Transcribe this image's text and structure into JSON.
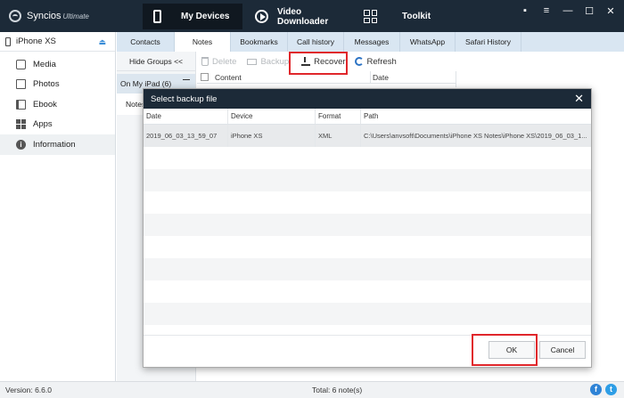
{
  "app": {
    "name": "Syncios",
    "edition": "Ultimate",
    "nav": [
      {
        "label": "My Devices",
        "icon": "phone-icon",
        "active": true
      },
      {
        "label": "Video Downloader",
        "icon": "play-icon",
        "active": false
      },
      {
        "label": "Toolkit",
        "icon": "toolkit-icon",
        "active": false
      }
    ],
    "window_controls": [
      "chat-icon",
      "menu-icon",
      "minimize-icon",
      "maximize-icon",
      "close-icon"
    ]
  },
  "sidebar": {
    "device": "iPhone XS",
    "items": [
      {
        "label": "Media",
        "icon": "media-icon"
      },
      {
        "label": "Photos",
        "icon": "photos-icon"
      },
      {
        "label": "Ebook",
        "icon": "ebook-icon"
      },
      {
        "label": "Apps",
        "icon": "apps-icon"
      },
      {
        "label": "Information",
        "icon": "information-icon",
        "active": true
      }
    ]
  },
  "tabs": [
    "Contacts",
    "Notes",
    "Bookmarks",
    "Call history",
    "Messages",
    "WhatsApp",
    "Safari History"
  ],
  "active_tab": "Notes",
  "groups": {
    "hide_label": "Hide Groups  <<",
    "group_label": "On My iPad (6)",
    "sub_label": "Notes"
  },
  "toolbar": {
    "delete": "Delete",
    "backup": "Backup",
    "recover": "Recover",
    "refresh": "Refresh"
  },
  "table": {
    "col_content": "Content",
    "col_date": "Date"
  },
  "status": {
    "version": "Version: 6.6.0",
    "total": "Total: 6 note(s)"
  },
  "modal": {
    "title": "Select backup file",
    "columns": {
      "date": "Date",
      "device": "Device",
      "format": "Format",
      "path": "Path"
    },
    "rows": [
      {
        "date": "2019_06_03_13_59_07",
        "device": "iPhone XS",
        "format": "XML",
        "path": "C:\\Users\\anvsoft\\Documents\\iPhone XS Notes\\iPhone XS\\2019_06_03_1..."
      }
    ],
    "ok": "OK",
    "cancel": "Cancel"
  },
  "colors": {
    "titlebar": "#1c2a38",
    "tabs_bg": "#d9e6f2",
    "highlight": "#e0262b"
  }
}
